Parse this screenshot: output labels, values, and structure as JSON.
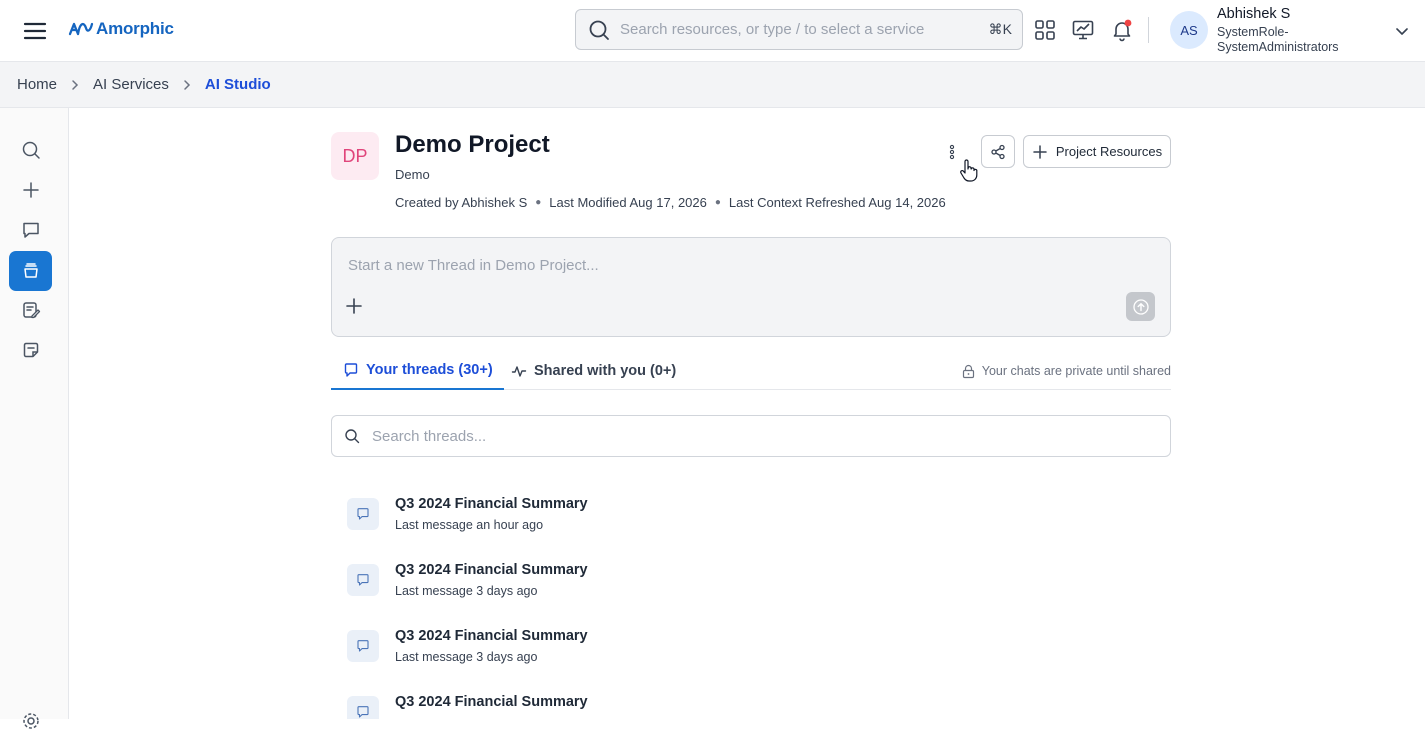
{
  "header": {
    "logo_text": "Amorphic",
    "search_placeholder": "Search resources, or type / to select a service",
    "search_shortcut": "⌘K",
    "user": {
      "initials": "AS",
      "name": "Abhishek S",
      "role": "SystemRole-SystemAdministrators"
    }
  },
  "breadcrumb": [
    {
      "label": "Home"
    },
    {
      "label": "AI Services"
    },
    {
      "label": "AI Studio"
    }
  ],
  "sidebar": {
    "items": [
      {
        "name": "search",
        "icon": "search-icon"
      },
      {
        "name": "new",
        "icon": "plus-icon"
      },
      {
        "name": "chats",
        "icon": "chat-bubble-icon"
      },
      {
        "name": "projects",
        "icon": "stack-icon",
        "active": true
      },
      {
        "name": "prompts",
        "icon": "edit-note-icon"
      },
      {
        "name": "notes",
        "icon": "sticky-note-icon"
      }
    ],
    "settings_icon": "gear-icon"
  },
  "project": {
    "initials": "DP",
    "title": "Demo Project",
    "subtitle": "Demo",
    "created_by": "Created by Abhishek S",
    "last_modified": "Last Modified Aug 17, 2026",
    "last_context_refreshed": "Last Context Refreshed Aug 14, 2026",
    "resources_button": "Project Resources"
  },
  "composer": {
    "placeholder": "Start a new Thread in Demo Project..."
  },
  "tabs": {
    "your_threads": "Your threads (30+)",
    "shared": "Shared with you (0+)",
    "private_note": "Your chats are private until shared"
  },
  "thread_search": {
    "placeholder": "Search threads..."
  },
  "threads": [
    {
      "title": "Q3 2024 Financial Summary",
      "subtitle": "Last message an hour ago"
    },
    {
      "title": "Q3 2024 Financial Summary",
      "subtitle": "Last message 3 days ago"
    },
    {
      "title": "Q3 2024 Financial Summary",
      "subtitle": "Last message 3 days ago"
    },
    {
      "title": "Q3 2024 Financial Summary",
      "subtitle": ""
    }
  ],
  "colors": {
    "accent": "#1976d2",
    "brand": "#1565c0",
    "project_avatar_bg": "#fdebf2",
    "project_avatar_fg": "#e0457b",
    "notification_dot": "#ef4444"
  }
}
